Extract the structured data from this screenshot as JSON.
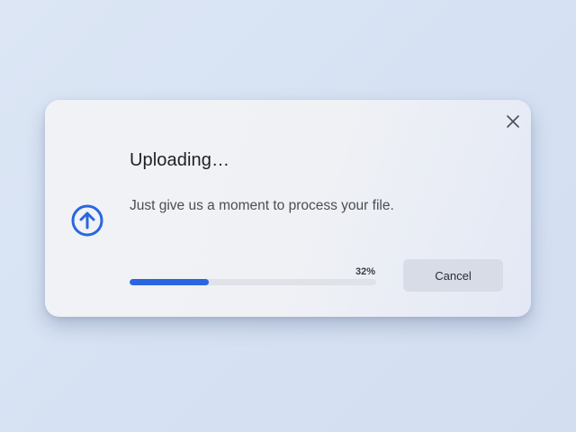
{
  "dialog": {
    "title": "Uploading…",
    "message": "Just give us a moment to process your file.",
    "progress": {
      "percent_label": "32%",
      "value": 0.32
    },
    "cancel_label": "Cancel",
    "icons": {
      "close": "close-icon",
      "upload": "upload-arrow-icon"
    },
    "colors": {
      "accent": "#2a66e0",
      "track": "#dfe2e8",
      "cancel_button": "#d8dce6"
    }
  }
}
